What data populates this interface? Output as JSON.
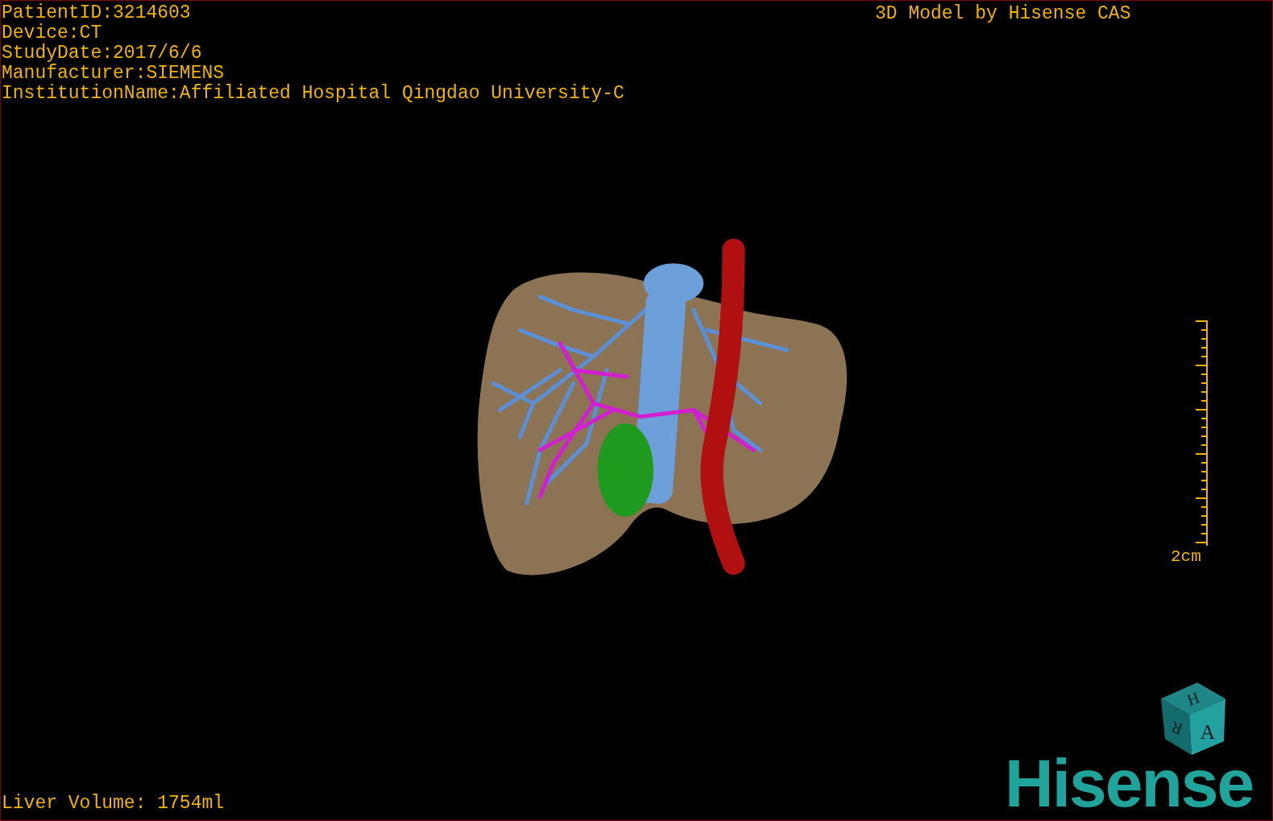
{
  "study_info": [
    "PatientID:3214603",
    "Device:CT",
    "StudyDate:2017/6/6",
    "Manufacturer:SIEMENS",
    "InstitutionName:Affiliated Hospital Qingdao University-C"
  ],
  "model_credit": "3D Model by Hisense CAS",
  "scale_bar": {
    "label": "2cm"
  },
  "liver_volume": "Liver Volume: 1754ml",
  "orientation_cube": {
    "top": "H",
    "side": "R",
    "front": "A"
  },
  "logo": "Hisense"
}
